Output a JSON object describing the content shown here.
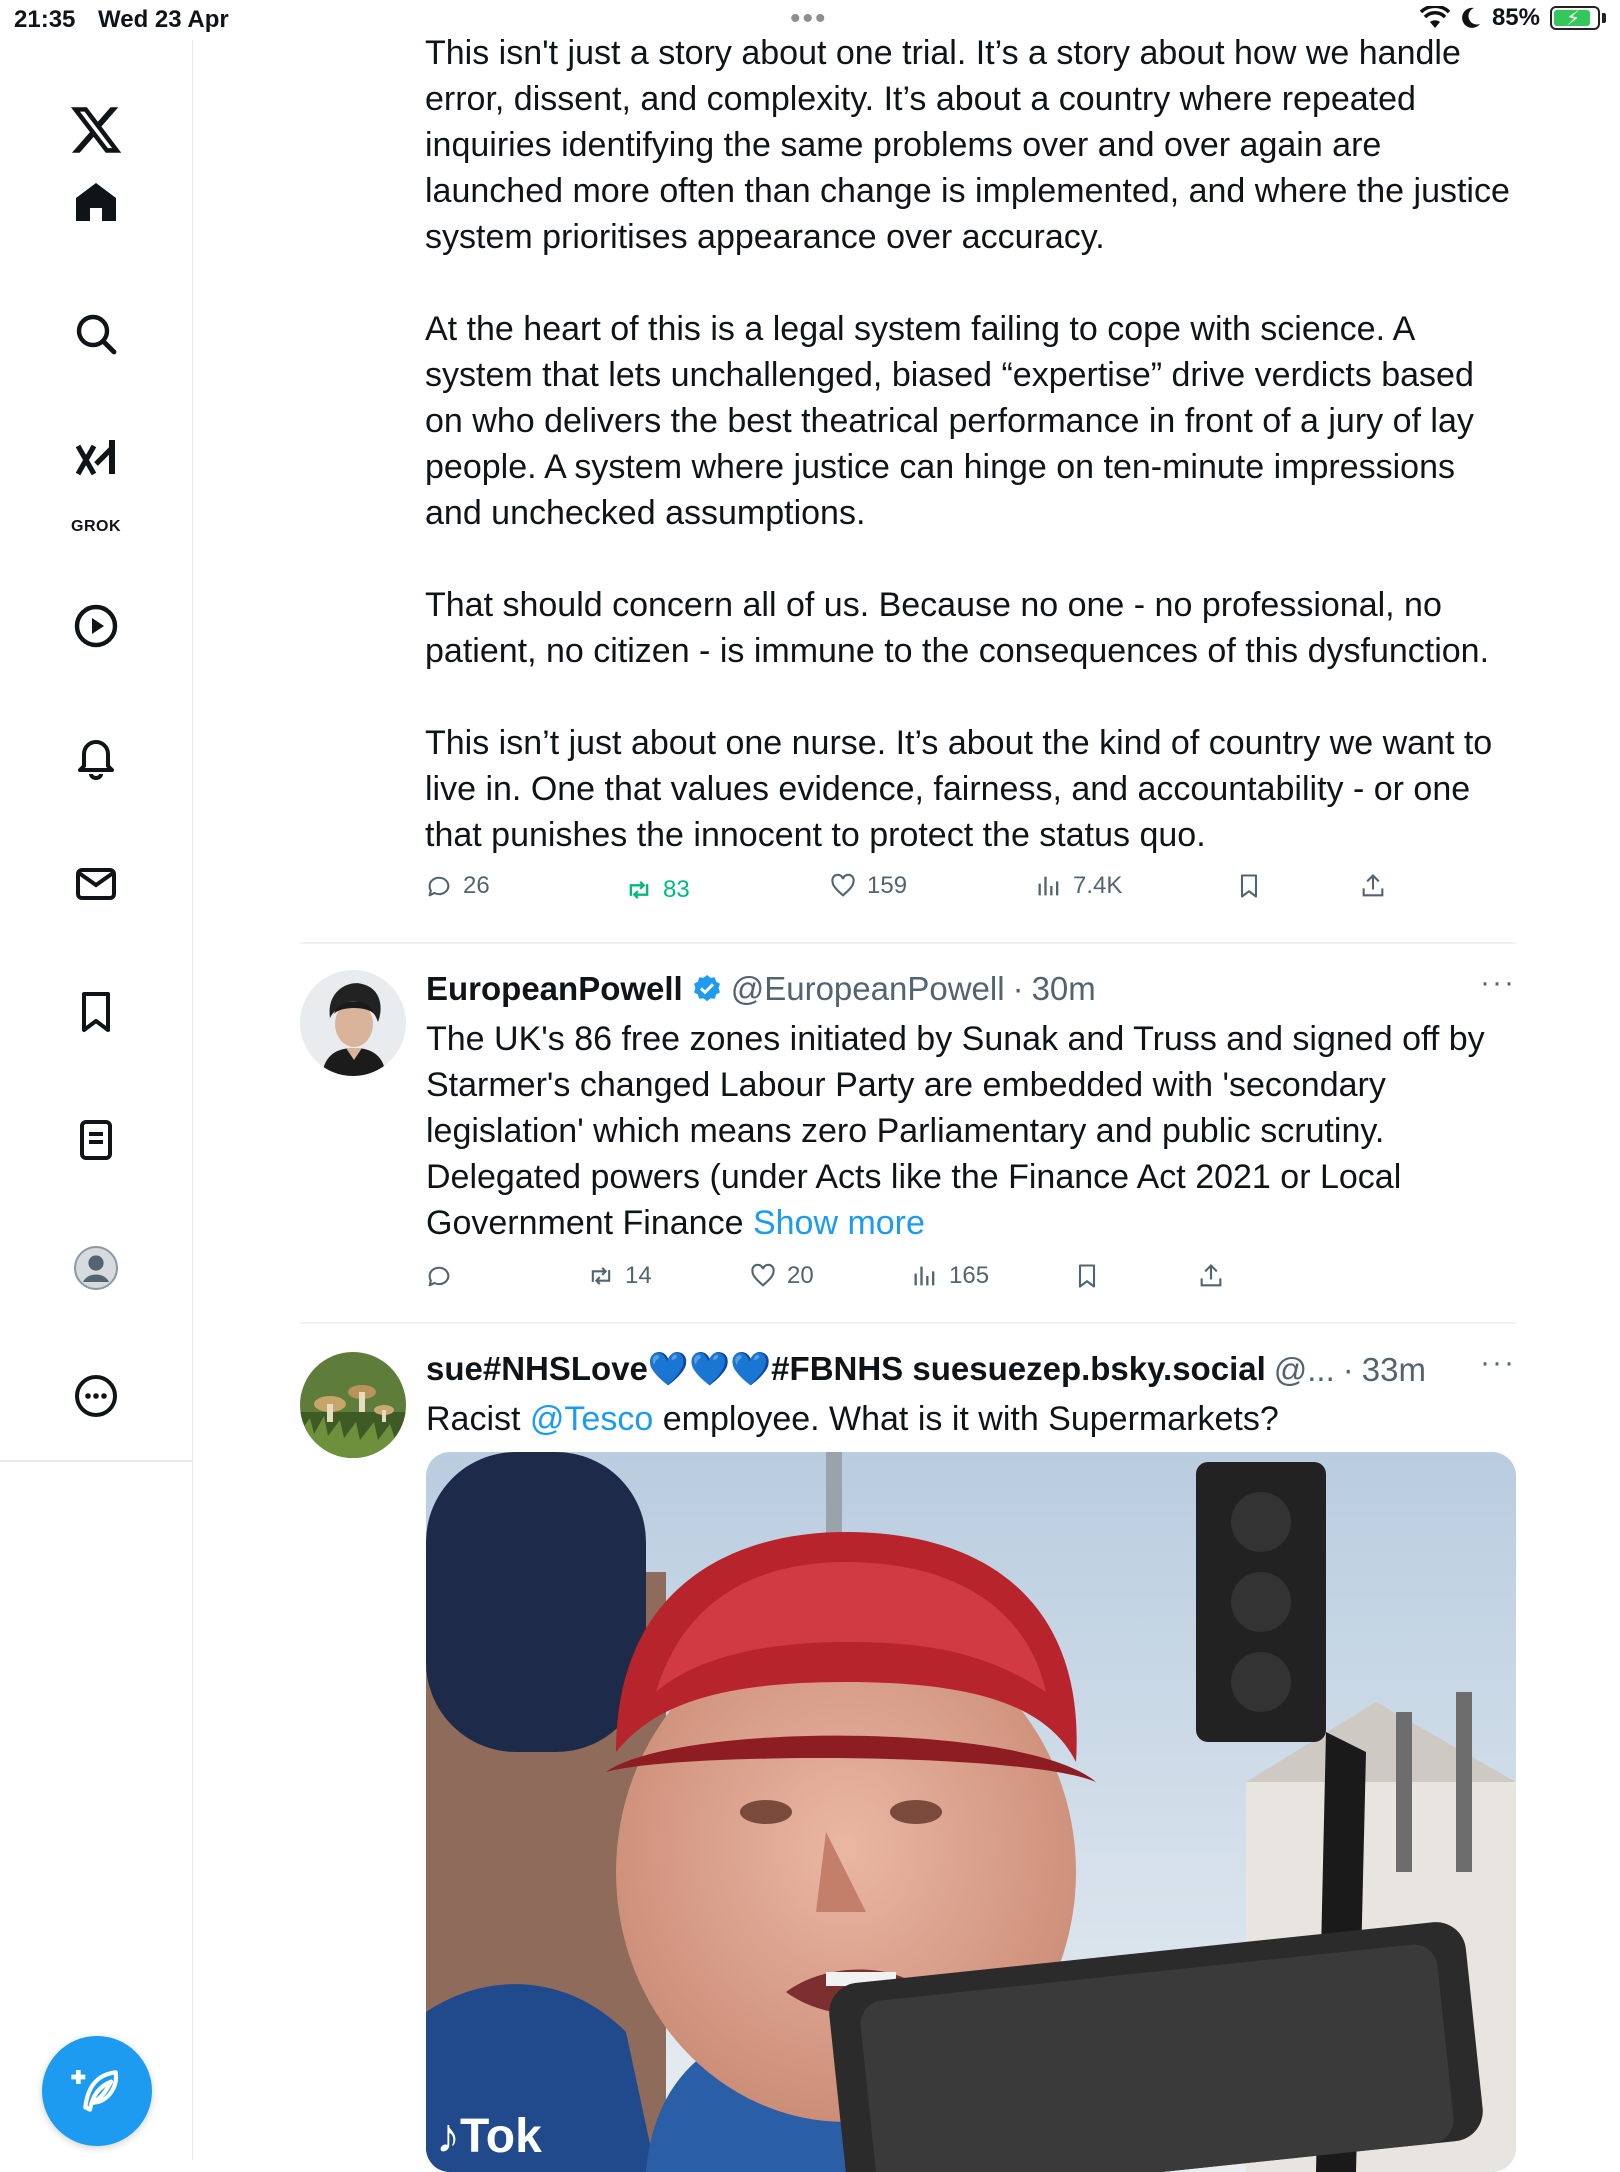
{
  "status_bar": {
    "time": "21:35",
    "date": "Wed 23 Apr",
    "battery": "85%",
    "battery_level": 0.85
  },
  "sidebar": {
    "grok_label": "GROK",
    "items": [
      "home-icon",
      "search-icon",
      "grok-icon",
      "video-icon",
      "notifications-icon",
      "messages-icon",
      "bookmarks-icon",
      "lists-icon",
      "profile-icon",
      "more-icon"
    ]
  },
  "thread_tweet": {
    "paragraphs": [
      "This isn't just a story about one trial. It’s a story about how we handle error, dissent, and complexity. It’s about a country where repeated inquiries identifying the same problems over and over again are launched more often than change is implemented, and where the justice system prioritises appearance over accuracy.",
      "At the heart of this is a legal system failing to cope with science. A system that lets unchallenged, biased “expertise” drive verdicts based on who delivers the best theatrical performance in front of a jury of lay people. A system where justice can hinge on ten-minute impressions and unchecked assumptions.",
      "That should concern all of us. Because no one - no professional, no patient, no citizen - is immune to the consequences of this dysfunction.",
      "This isn’t just about one nurse. It’s about the kind of country we want to live in. One that values evidence, fairness, and accountability - or one that punishes the innocent to protect the status quo."
    ],
    "replies": "26",
    "reposts": "83",
    "likes": "159",
    "views": "7.4K"
  },
  "tweet_powell": {
    "name": "EuropeanPowell",
    "handle": "@EuropeanPowell",
    "separator": "·",
    "time": "30m",
    "text": "The UK's 86 free zones initiated by Sunak and Truss and signed off by Starmer's changed Labour Party are embedded with 'secondary legislation' which means zero Parliamentary and public scrutiny. Delegated powers (under Acts like the Finance Act 2021 or Local Government Finance",
    "show_more": "Show more",
    "replies": "",
    "reposts": "14",
    "likes": "20",
    "views": "165"
  },
  "tweet_sue": {
    "name": "sue#NHSLove💙💙💙#FBNHS suesuezep.bsky.social",
    "handle": "@...",
    "separator": "·",
    "time": "33m",
    "text_before": "Racist ",
    "mention": "@Tesco",
    "text_after": " employee. What is it with Supermarkets?"
  },
  "colors": {
    "accent": "#1d9bf0",
    "retweet": "#00ba7c",
    "secondary_text": "#536471"
  }
}
